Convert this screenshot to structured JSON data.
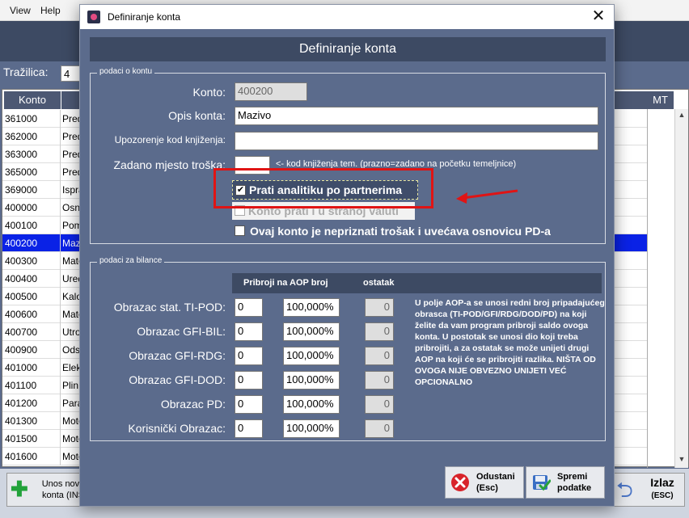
{
  "background": {
    "menu": [
      "View",
      "Help"
    ],
    "search_label": "Tražilica:",
    "search_value": "4",
    "table": {
      "col_konto": "Konto",
      "col_mt": "MT",
      "rows": [
        {
          "konto": "361000",
          "opis": "Pred"
        },
        {
          "konto": "362000",
          "opis": "Pred"
        },
        {
          "konto": "363000",
          "opis": "Pred"
        },
        {
          "konto": "365000",
          "opis": "Pred"
        },
        {
          "konto": "369000",
          "opis": "Ispra"
        },
        {
          "konto": "400000",
          "opis": "Osno"
        },
        {
          "konto": "400100",
          "opis": "Pom"
        },
        {
          "konto": "400200",
          "opis": "Mazi"
        },
        {
          "konto": "400300",
          "opis": "Mate"
        },
        {
          "konto": "400400",
          "opis": "Ured"
        },
        {
          "konto": "400500",
          "opis": "Kalo"
        },
        {
          "konto": "400600",
          "opis": "Mate"
        },
        {
          "konto": "400700",
          "opis": "Utro"
        },
        {
          "konto": "400900",
          "opis": "Ods"
        },
        {
          "konto": "401000",
          "opis": "Elek"
        },
        {
          "konto": "401100",
          "opis": "Plin"
        },
        {
          "konto": "401200",
          "opis": "Para"
        },
        {
          "konto": "401300",
          "opis": "Moto"
        },
        {
          "konto": "401500",
          "opis": "Moto"
        },
        {
          "konto": "401600",
          "opis": "Moto"
        }
      ],
      "selected_index": 7
    },
    "add_button": "Unos novo\nkonta (INS",
    "exit_button": {
      "label": "Izlaz",
      "sub": "(ESC)"
    }
  },
  "dialog": {
    "window_title": "Definiranje konta",
    "header": "Definiranje konta",
    "group_konto": {
      "legend": "podaci o kontu",
      "konto_label": "Konto:",
      "konto_value": "400200",
      "opis_label": "Opis konta:",
      "opis_value": "Mazivo",
      "upozorenje_label": "Upozorenje kod knjiženja:",
      "upozorenje_value": "",
      "mjesto_label": "Zadano mjesto troška:",
      "mjesto_value": "",
      "mjesto_hint": "<- kod knjiženja tem. (prazno=zadano na početku temeljnice)",
      "cb_analitika": "Prati analitiku po partnerima",
      "cb_valuta": "Konto prati i u stranoj valuti",
      "cb_nepriznati": "Ovaj konto je nepriznati trošak i uvećava osnovicu PD-a"
    },
    "group_bilance": {
      "legend": "podaci za bilance",
      "head_pribroji": "Pribroji na AOP broj",
      "head_ostatak": "ostatak",
      "rows": [
        {
          "label": "Obrazac stat. TI-POD:",
          "aop": "0",
          "pct": "100,000%",
          "ostatak": "0"
        },
        {
          "label": "Obrazac GFI-BIL:",
          "aop": "0",
          "pct": "100,000%",
          "ostatak": "0"
        },
        {
          "label": "Obrazac GFI-RDG:",
          "aop": "0",
          "pct": "100,000%",
          "ostatak": "0"
        },
        {
          "label": "Obrazac GFI-DOD:",
          "aop": "0",
          "pct": "100,000%",
          "ostatak": "0"
        },
        {
          "label": "Obrazac PD:",
          "aop": "0",
          "pct": "100,000%",
          "ostatak": "0"
        },
        {
          "label": "Korisnički Obrazac:",
          "aop": "0",
          "pct": "100,000%",
          "ostatak": "0"
        }
      ],
      "info": "U polje AOP-a se unosi redni broj pripadajućeg obrasca (TI-POD/GFI/RDG/DOD/PD) na koji želite da vam program pribroji saldo ovoga konta. U postotak se unosi dio koji treba pribrojiti, a za ostatak se može unijeti drugi AOP na koji će se pribrojiti razlika. NIŠTA OD OVOGA NIJE OBVEZNO UNIJETI VEĆ OPCIONALNO"
    },
    "btn_odustani": {
      "l1": "Odustani",
      "l2": "(Esc)"
    },
    "btn_spremi": {
      "l1": "Spremi",
      "l2": "podatke"
    }
  },
  "colors": {
    "highlight": "#e01414",
    "selection": "#0a22e6",
    "panel": "#5b6b8c",
    "band": "#3d4a63"
  }
}
